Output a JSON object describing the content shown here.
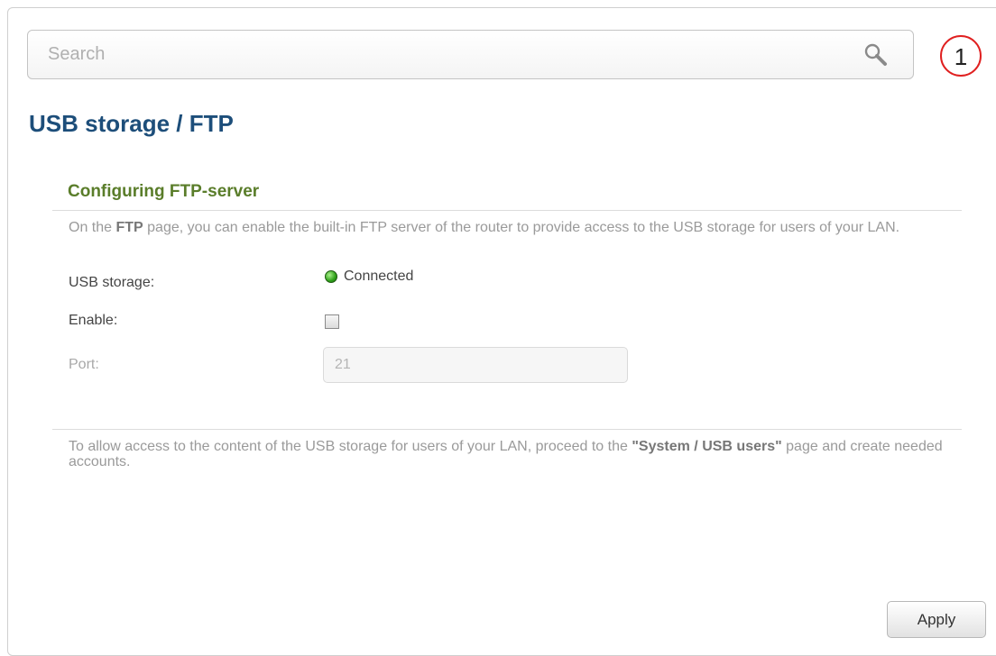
{
  "search": {
    "placeholder": "Search"
  },
  "badge": {
    "number": "1",
    "color": "#e02020"
  },
  "page": {
    "title": "USB storage /  FTP"
  },
  "section": {
    "title": "Configuring FTP-server",
    "description": {
      "pre": "On the ",
      "bold": "FTP",
      "post": " page, you can enable the built-in FTP server of the router to provide access to the USB storage for users of your LAN."
    }
  },
  "form": {
    "usb_storage": {
      "label": "USB storage:",
      "status": "Connected",
      "status_color": "#2ea019"
    },
    "enable": {
      "label": "Enable:",
      "checked": false
    },
    "port": {
      "label": "Port:",
      "value": "21",
      "disabled": true
    }
  },
  "note": {
    "pre": "To allow access to the content of the USB storage for users of your LAN, proceed to the ",
    "bold": "\"System / USB users\"",
    "post": " page and create needed accounts."
  },
  "actions": {
    "apply_label": "Apply"
  },
  "colors": {
    "title": "#1d4e7a",
    "section_title": "#5a7d2a"
  }
}
